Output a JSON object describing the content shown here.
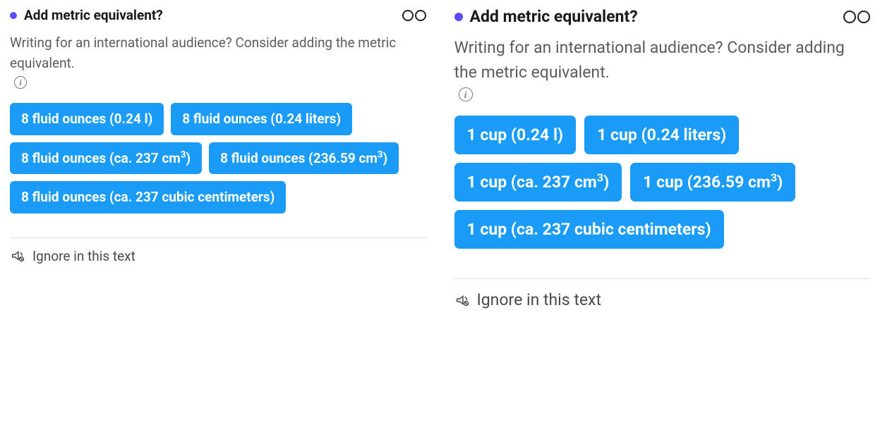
{
  "panels": [
    {
      "title": "Add metric equivalent?",
      "description": "Writing for an international audience? Consider adding the metric equivalent.",
      "suggestions": [
        "8 fluid ounces (0.24 l)",
        "8 fluid ounces (0.24 liters)",
        "8 fluid ounces (ca. 237 cm³)",
        "8 fluid ounces (236.59 cm³)",
        "8 fluid ounces (ca. 237 cubic centimeters)"
      ],
      "ignore_label": "Ignore in this text"
    },
    {
      "title": "Add metric equivalent?",
      "description": "Writing for an international audience? Consider adding the metric equivalent.",
      "suggestions": [
        "1 cup (0.24 l)",
        "1 cup (0.24 liters)",
        "1 cup (ca. 237 cm³)",
        "1 cup (236.59 cm³)",
        "1 cup (ca. 237 cubic centimeters)"
      ],
      "ignore_label": "Ignore in this text"
    }
  ]
}
